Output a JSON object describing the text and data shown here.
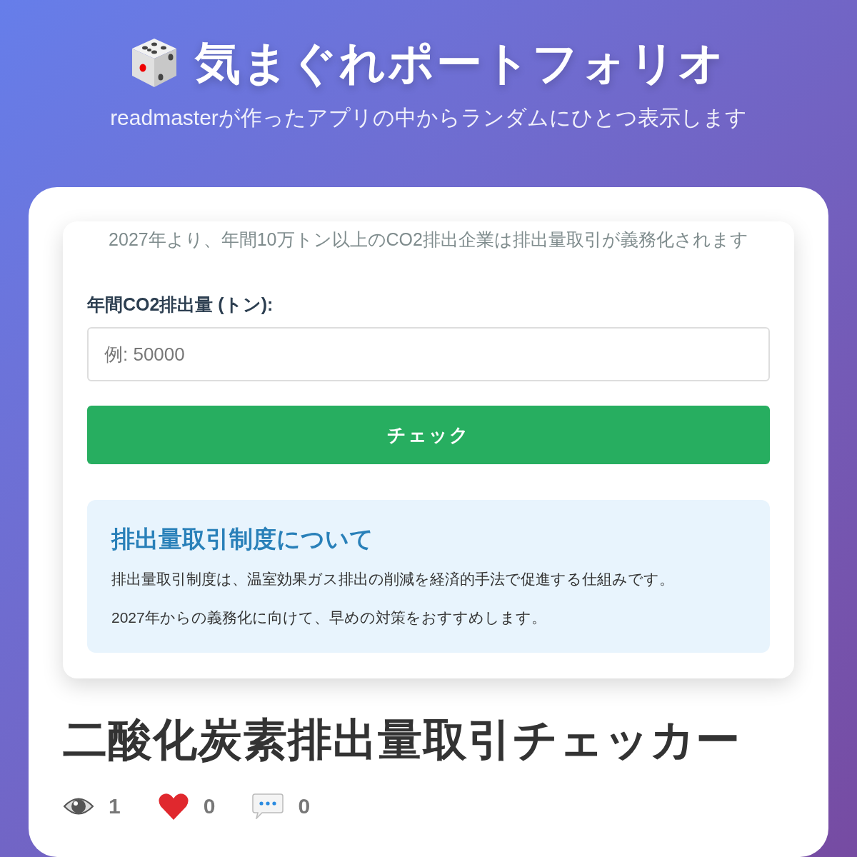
{
  "header": {
    "title": "気まぐれポートフォリオ",
    "subtitle": "readmasterが作ったアプリの中からランダムにひとつ表示します"
  },
  "preview": {
    "notice": "2027年より、年間10万トン以上のCO2排出企業は排出量取引が義務化されます",
    "field": {
      "label": "年間CO2排出量 (トン):",
      "placeholder": "例: 50000"
    },
    "button": "チェック",
    "info": {
      "heading": "排出量取引制度について",
      "paragraphs": [
        "排出量取引制度は、温室効果ガス排出の削減を経済的手法で促進する仕組みです。",
        "2027年からの義務化に向けて、早めの対策をおすすめします。"
      ]
    }
  },
  "app_title": "二酸化炭素排出量取引チェッカー",
  "stats": [
    {
      "kind": "views",
      "count": "1"
    },
    {
      "kind": "likes",
      "count": "0"
    },
    {
      "kind": "comments",
      "count": "0"
    }
  ]
}
